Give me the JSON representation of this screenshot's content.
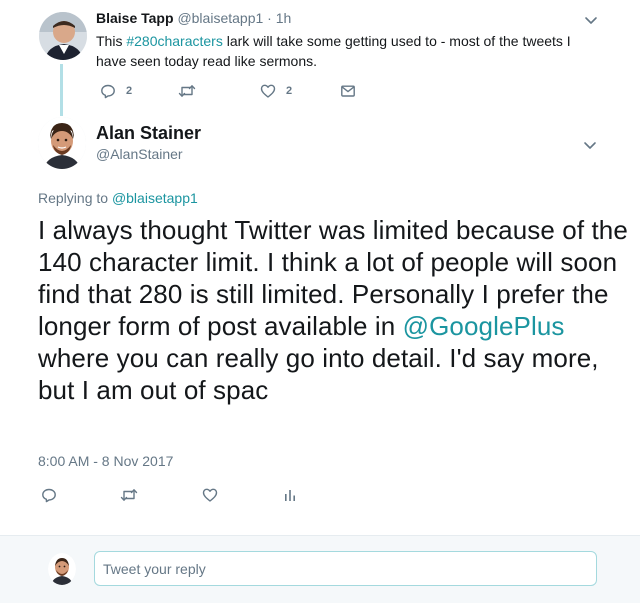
{
  "parent_tweet": {
    "author_name": "Blaise Tapp",
    "author_handle": "@blaisetapp1",
    "time": "1h",
    "text_before_link": "This ",
    "hashtag": "#280characters",
    "text_after_link": " lark will take some getting used to - most of the tweets I have seen today  read like sermons.",
    "reply_count": "2",
    "like_count": "2",
    "avatar_icon": "person-avatar-icon"
  },
  "main_tweet": {
    "author_name": "Alan Stainer",
    "author_handle": "@AlanStainer",
    "replying_label": "Replying to",
    "replying_to": "@blaisetapp1",
    "text_before_mention": "I always thought Twitter was limited because of the 140 character limit. I think a lot of people will soon find that 280 is still limited. Personally I prefer the longer form of post available in ",
    "mention": "@GooglePlus",
    "text_after_mention": " where you can really go into detail. I'd say more, but I am out of spac",
    "timestamp": "8:00 AM - 8 Nov 2017",
    "avatar_icon": "person-avatar-icon"
  },
  "reply_box": {
    "placeholder": "Tweet your reply",
    "value": ""
  },
  "colors": {
    "link": "#1b95a0",
    "muted": "#657786",
    "text": "#14171a",
    "thread_line": "#b2dfe6",
    "reply_border": "#a4d9de",
    "reply_bar_bg": "#f5f8fa"
  }
}
